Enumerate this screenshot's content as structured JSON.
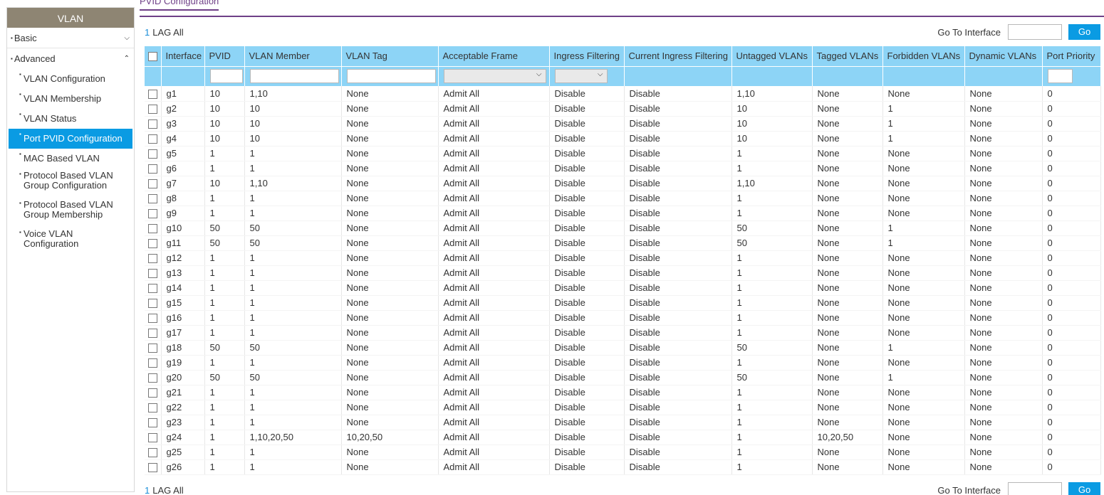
{
  "sidebar": {
    "title": "VLAN",
    "groups": [
      {
        "label": "Basic",
        "chevron": "⌄"
      },
      {
        "label": "Advanced",
        "chevron": "⌃"
      }
    ],
    "items": [
      {
        "label": "VLAN Configuration"
      },
      {
        "label": "VLAN Membership"
      },
      {
        "label": "VLAN Status"
      },
      {
        "label": "Port PVID Configuration"
      },
      {
        "label": "MAC Based VLAN"
      },
      {
        "label": "Protocol Based VLAN Group Configuration"
      },
      {
        "label": "Protocol Based VLAN Group Membership"
      },
      {
        "label": "Voice VLAN Configuration"
      }
    ]
  },
  "page": {
    "title": "PVID Configuration"
  },
  "toolbar": {
    "lag_number": "1",
    "lag_label": "LAG All",
    "goto_label": "Go To Interface",
    "go_label": "Go"
  },
  "table": {
    "columns": [
      "Interface",
      "PVID",
      "VLAN Member",
      "VLAN Tag",
      "Acceptable Frame",
      "Ingress Filtering",
      "Current Ingress Filtering",
      "Untagged VLANs",
      "Tagged VLANs",
      "Forbidden VLANs",
      "Dynamic VLANs",
      "Port Priority"
    ],
    "rows": [
      [
        "g1",
        "10",
        "1,10",
        "None",
        "Admit All",
        "Disable",
        "Disable",
        "1,10",
        "None",
        "None",
        "None",
        "0"
      ],
      [
        "g2",
        "10",
        "10",
        "None",
        "Admit All",
        "Disable",
        "Disable",
        "10",
        "None",
        "1",
        "None",
        "0"
      ],
      [
        "g3",
        "10",
        "10",
        "None",
        "Admit All",
        "Disable",
        "Disable",
        "10",
        "None",
        "1",
        "None",
        "0"
      ],
      [
        "g4",
        "10",
        "10",
        "None",
        "Admit All",
        "Disable",
        "Disable",
        "10",
        "None",
        "1",
        "None",
        "0"
      ],
      [
        "g5",
        "1",
        "1",
        "None",
        "Admit All",
        "Disable",
        "Disable",
        "1",
        "None",
        "None",
        "None",
        "0"
      ],
      [
        "g6",
        "1",
        "1",
        "None",
        "Admit All",
        "Disable",
        "Disable",
        "1",
        "None",
        "None",
        "None",
        "0"
      ],
      [
        "g7",
        "10",
        "1,10",
        "None",
        "Admit All",
        "Disable",
        "Disable",
        "1,10",
        "None",
        "None",
        "None",
        "0"
      ],
      [
        "g8",
        "1",
        "1",
        "None",
        "Admit All",
        "Disable",
        "Disable",
        "1",
        "None",
        "None",
        "None",
        "0"
      ],
      [
        "g9",
        "1",
        "1",
        "None",
        "Admit All",
        "Disable",
        "Disable",
        "1",
        "None",
        "None",
        "None",
        "0"
      ],
      [
        "g10",
        "50",
        "50",
        "None",
        "Admit All",
        "Disable",
        "Disable",
        "50",
        "None",
        "1",
        "None",
        "0"
      ],
      [
        "g11",
        "50",
        "50",
        "None",
        "Admit All",
        "Disable",
        "Disable",
        "50",
        "None",
        "1",
        "None",
        "0"
      ],
      [
        "g12",
        "1",
        "1",
        "None",
        "Admit All",
        "Disable",
        "Disable",
        "1",
        "None",
        "None",
        "None",
        "0"
      ],
      [
        "g13",
        "1",
        "1",
        "None",
        "Admit All",
        "Disable",
        "Disable",
        "1",
        "None",
        "None",
        "None",
        "0"
      ],
      [
        "g14",
        "1",
        "1",
        "None",
        "Admit All",
        "Disable",
        "Disable",
        "1",
        "None",
        "None",
        "None",
        "0"
      ],
      [
        "g15",
        "1",
        "1",
        "None",
        "Admit All",
        "Disable",
        "Disable",
        "1",
        "None",
        "None",
        "None",
        "0"
      ],
      [
        "g16",
        "1",
        "1",
        "None",
        "Admit All",
        "Disable",
        "Disable",
        "1",
        "None",
        "None",
        "None",
        "0"
      ],
      [
        "g17",
        "1",
        "1",
        "None",
        "Admit All",
        "Disable",
        "Disable",
        "1",
        "None",
        "None",
        "None",
        "0"
      ],
      [
        "g18",
        "50",
        "50",
        "None",
        "Admit All",
        "Disable",
        "Disable",
        "50",
        "None",
        "1",
        "None",
        "0"
      ],
      [
        "g19",
        "1",
        "1",
        "None",
        "Admit All",
        "Disable",
        "Disable",
        "1",
        "None",
        "None",
        "None",
        "0"
      ],
      [
        "g20",
        "50",
        "50",
        "None",
        "Admit All",
        "Disable",
        "Disable",
        "50",
        "None",
        "1",
        "None",
        "0"
      ],
      [
        "g21",
        "1",
        "1",
        "None",
        "Admit All",
        "Disable",
        "Disable",
        "1",
        "None",
        "None",
        "None",
        "0"
      ],
      [
        "g22",
        "1",
        "1",
        "None",
        "Admit All",
        "Disable",
        "Disable",
        "1",
        "None",
        "None",
        "None",
        "0"
      ],
      [
        "g23",
        "1",
        "1",
        "None",
        "Admit All",
        "Disable",
        "Disable",
        "1",
        "None",
        "None",
        "None",
        "0"
      ],
      [
        "g24",
        "1",
        "1,10,20,50",
        "10,20,50",
        "Admit All",
        "Disable",
        "Disable",
        "1",
        "10,20,50",
        "None",
        "None",
        "0"
      ],
      [
        "g25",
        "1",
        "1",
        "None",
        "Admit All",
        "Disable",
        "Disable",
        "1",
        "None",
        "None",
        "None",
        "0"
      ],
      [
        "g26",
        "1",
        "1",
        "None",
        "Admit All",
        "Disable",
        "Disable",
        "1",
        "None",
        "None",
        "None",
        "0"
      ]
    ]
  },
  "colors": {
    "accent": "#0a9be3",
    "header_bg": "#8dd4f6",
    "sidebar_header": "#8e8573",
    "tab_purple": "#6e3f87"
  }
}
